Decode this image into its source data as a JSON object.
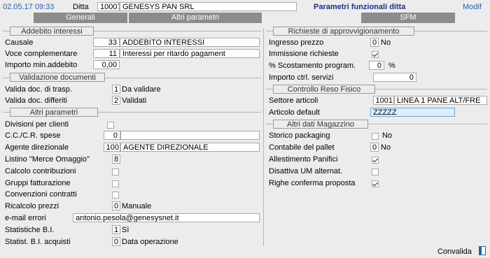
{
  "header": {
    "timestamp": "02.05.17 09:33",
    "ditta_label": "Ditta",
    "ditta_code": "10007",
    "ditta_name": "GENESYS PAN SRL",
    "title": "Parametri funzionali ditta",
    "mode": "Modif"
  },
  "tabs": {
    "generali": "Generali",
    "altri": "Altri parametri",
    "sfm": "SFM"
  },
  "left": {
    "addebito": {
      "title": "Addebito interessi",
      "causale_label": "Causale",
      "causale_code": "33",
      "causale_desc": "ADDEBITO INTERESSI",
      "voce_label": "Voce complementare",
      "voce_code": "11",
      "voce_desc": "Interessi per ritardo pagament",
      "importo_label": "Importo min.addebito",
      "importo_value": "0,00"
    },
    "validazione": {
      "title": "Validazione documenti",
      "trasp_label": "Valida doc. di trasp.",
      "trasp_value": "1",
      "trasp_desc": "Da validare",
      "diff_label": "Valida doc. differiti",
      "diff_value": "2",
      "diff_desc": "Validati"
    },
    "altri": {
      "title": "Altri parametri",
      "divisioni_label": "Divisioni per clienti",
      "ccspese_label": "C.C./C.R. spese",
      "ccspese_value": "0",
      "agente_label": "Agente  direzionale",
      "agente_code": "100",
      "agente_desc": "AGENTE DIREZIONALE",
      "listino_label": "Listino \"Merce Omaggio\"",
      "listino_value": "8",
      "calcolo_label": "Calcolo contribuzioni",
      "gruppi_label": "Gruppi  fatturazione",
      "convenzioni_label": "Convenzioni contratti",
      "ricalcolo_label": "Ricalcolo prezzi",
      "ricalcolo_value": "0",
      "ricalcolo_desc": "Manuale",
      "email_label": "e-mail errori",
      "email_value": "antonio.pesola@genesysnet.it",
      "stat_label": "Statistiche B.I.",
      "stat_value": "1",
      "stat_desc": "Sì",
      "statacq_label": "Statist. B.I. acquisti",
      "statacq_value": "0",
      "statacq_desc": "Data operazione"
    }
  },
  "right": {
    "richieste": {
      "title": "Richieste di approvvigionamento",
      "ingresso_label": "Ingresso prezzo",
      "ingresso_value": "0",
      "ingresso_desc": "No",
      "immissione_label": "Immissione richieste",
      "scost_label": "% Scostamento program.",
      "scost_value": "0",
      "scost_unit": "%",
      "importo_label": "Importo ctrl. servizi",
      "importo_value": "0"
    },
    "reso": {
      "title": "Controllo Reso Fisico",
      "settore_label": "Settore articoli",
      "settore_code": "1001",
      "settore_desc": "LINEA 1 PANE ALT/FRE",
      "articolo_label": "Articolo default",
      "articolo_value": "ZZZZZ"
    },
    "magazzino": {
      "title": "Altri dati Magazzino",
      "storico_label": "Storico packaging",
      "storico_desc": "No",
      "contabile_label": "Contabile del pallet",
      "contabile_value": "0",
      "contabile_desc": "No",
      "allestimento_label": "Allestimento Panifici",
      "disattiva_label": "Disattiva UM alternat.",
      "righe_label": "Righe conferma proposta"
    }
  },
  "footer": {
    "convalida": "Convalida"
  },
  "colors": {
    "title": "#1f2d8a",
    "timestamp": "#2a5fa8",
    "tab": "#8c8c8c",
    "highlight": "#dbeefb"
  }
}
